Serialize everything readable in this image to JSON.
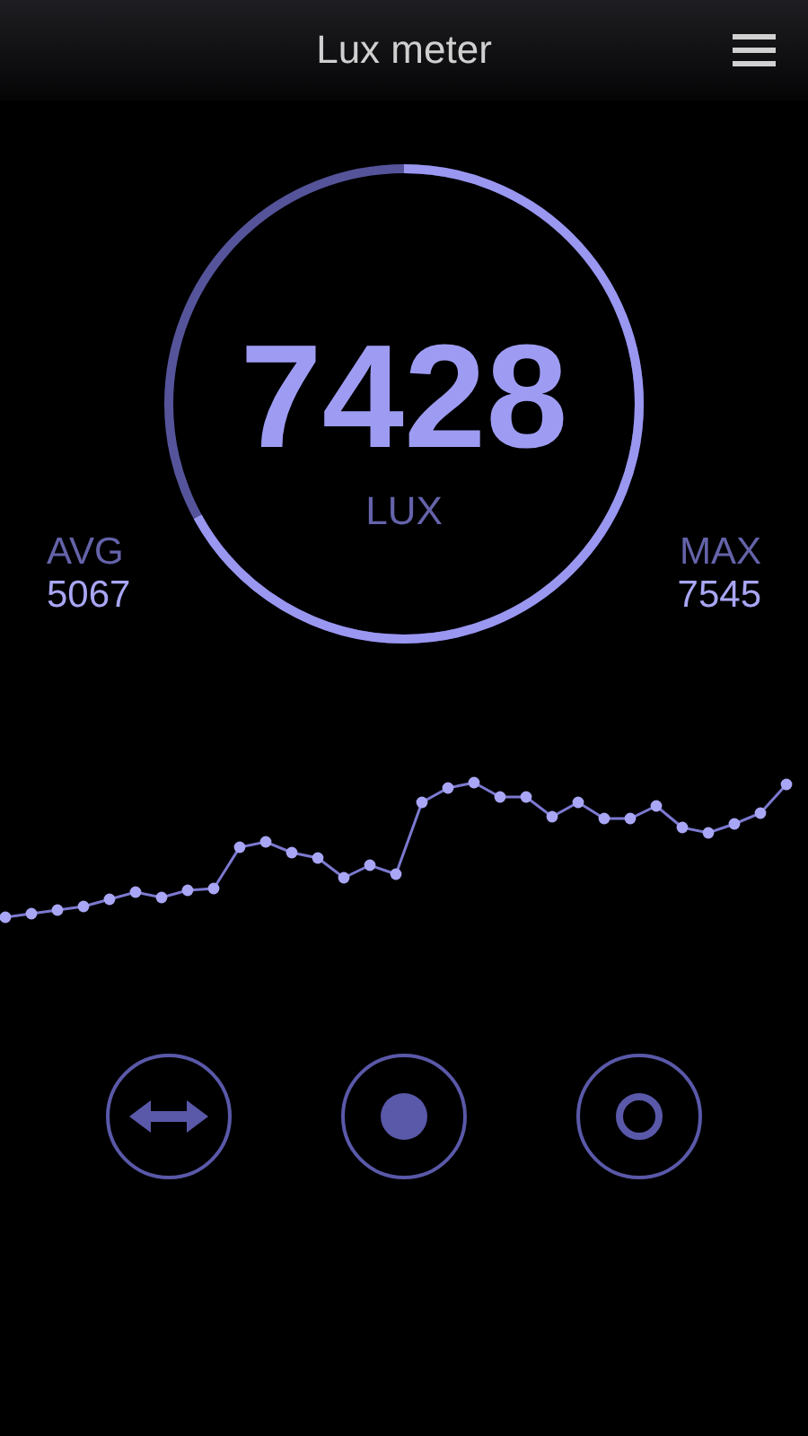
{
  "app_bar": {
    "title": "Lux meter"
  },
  "gauge": {
    "reading": "7428",
    "unit": "LUX",
    "level": 0.67
  },
  "stats": [
    {
      "label": "AVG",
      "value": "5067"
    },
    {
      "label": "MAX",
      "value": "7545"
    }
  ]
}
